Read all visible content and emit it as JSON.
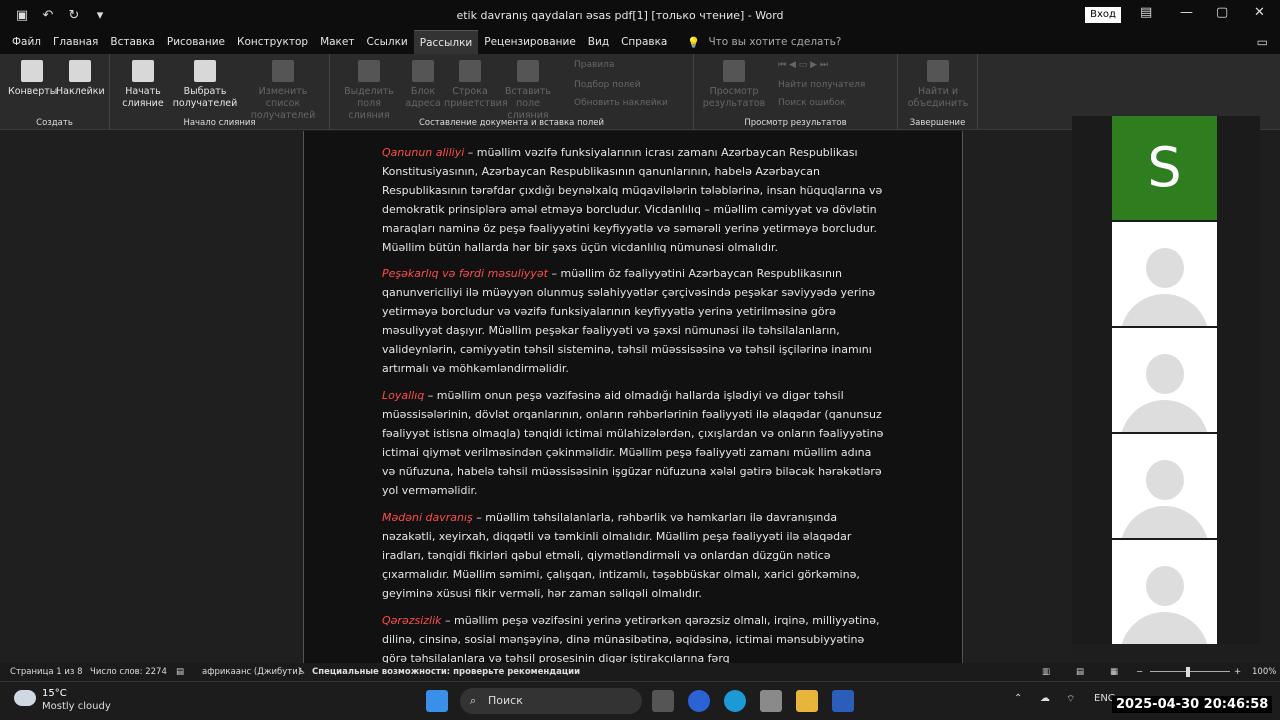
{
  "titlebar": {
    "title": "etik davranış qaydaları əsas pdf[1] [только чтение] - Word",
    "signin": "Вход"
  },
  "menu": [
    "Файл",
    "Главная",
    "Вставка",
    "Рисование",
    "Конструктор",
    "Макет",
    "Ссылки",
    "Рассылки",
    "Рецензирование",
    "Вид",
    "Справка"
  ],
  "menu_active": "Рассылки",
  "tellme": "Что вы хотите сделать?",
  "ribbon": {
    "groups": [
      "Создать",
      "Начало слияния",
      "Составление документа и вставка полей",
      "Просмотр результатов",
      "Завершение"
    ],
    "create": {
      "envelopes": "Конверты",
      "labels": "Наклейки"
    },
    "start": {
      "start_merge": "Начать слияние",
      "select_recipients": "Выбрать получателей",
      "edit_list": "Изменить список получателей"
    },
    "write": {
      "highlight": "Выделить поля слияния",
      "address": "Блок адреса",
      "greeting": "Строка приветствия",
      "insert_field": "Вставить поле слияния",
      "rules": "Правила",
      "match": "Подбор полей",
      "update": "Обновить наклейки"
    },
    "preview": {
      "preview": "Просмотр результатов",
      "find_recipient": "Найти получателя",
      "check_errors": "Поиск ошибок"
    },
    "finish": {
      "finish": "Найти и объединить"
    }
  },
  "document": {
    "paragraphs": [
      {
        "term": "Qanunun aliliyi",
        "text": " – müəllim vəzifə funksiyalarının icrası zamanı Azərbaycan Respublikası Konstitusiyasının, Azərbaycan Respublikasının qanunlarının, habelə Azərbaycan Respublikasının tərəfdar çıxdığı beynəlxalq müqavilələrin tələblərinə, insan hüquqlarına və demokratik prinsiplərə əməl etməyə borcludur. Vicdanlılıq – müəllim cəmiyyət və dövlətin maraqları naminə öz peşə fəaliyyətini keyfiyyətlə və səmərəli yerinə yetirməyə borcludur. Müəllim bütün hallarda hər bir şəxs üçün vicdanlılıq nümunəsi olmalıdır."
      },
      {
        "term": "Peşəkarlıq və fərdi məsuliyyət",
        "text": " – müəllim öz fəaliyyətini Azərbaycan Respublikasının qanunvericiliyi ilə müəyyən olunmuş səlahiyyətlər çərçivəsində peşəkar səviyyədə yerinə yetirməyə borcludur və vəzifə funksiyalarının keyfiyyətlə yerinə yetirilməsinə görə məsuliyyət daşıyır. Müəllim peşəkar fəaliyyəti və şəxsi nümunəsi ilə təhsilalanların, valideynlərin, cəmiyyətin təhsil sisteminə, təhsil müəssisəsinə və təhsil işçilərinə inamını artırmalı və möhkəmləndirməlidir."
      },
      {
        "term": "Loyallıq",
        "text": " – müəllim onun peşə vəzifəsinə aid olmadığı hallarda işlədiyi və digər təhsil müəssisələrinin, dövlət orqanlarının, onların rəhbərlərinin fəaliyyəti ilə əlaqədar (qanunsuz fəaliyyət istisna olmaqla) tənqidi ictimai mülahizələrdən, çıxışlardan və onların fəaliyyətinə ictimai qiymət verilməsindən çəkinməlidir. Müəllim peşə fəaliyyəti zamanı müəllim adına və nüfuzuna, habelə təhsil müəssisəsinin işgüzar nüfuzuna xələl gətirə biləcək hərəkətlərə yol verməməlidir."
      },
      {
        "term": "Mədəni davranış",
        "text": " – müəllim təhsilalanlarla, rəhbərlik və həmkarları ilə davranışında nəzakətli, xeyirxah, diqqətli və təmkinli olmalıdır. Müəllim peşə fəaliyyəti ilə əlaqədar iradları, tənqidi fikirləri qəbul etməli, qiymətləndirməli və onlardan düzgün nəticə çıxarmalıdır. Müəllim səmimi, çalışqan, intizamlı, təşəbbüskar olmalı, xarici görkəminə, geyiminə xüsusi fikir verməli, hər zaman səliqəli olmalıdır."
      },
      {
        "term": "Qərəzsizlik",
        "text": " – müəllim peşə vəzifəsini yerinə yetirərkən qərəzsiz olmalı, irqinə, milliyyətinə, dilinə, cinsinə, sosial mənşəyinə, dinə münasibətinə, əqidəsinə, ictimai mənsubiyyətinə görə təhsilalanlara və təhsil prosesinin digər iştirakçılarına fərq"
      }
    ]
  },
  "video": {
    "presenter_initial": "S"
  },
  "status": {
    "page": "Страница 1 из 8",
    "words": "Число слов: 2274",
    "language": "африкаанс (Джибути)",
    "accessibility": "Специальные возможности: проверьте рекомендации",
    "zoom": "100%"
  },
  "taskbar": {
    "temp": "15°C",
    "weather": "Mostly cloudy",
    "search": "Поиск",
    "lang": "ENG",
    "clock": "2025-04-30 20:46:58"
  },
  "colors": {
    "term": "#ff4d4d",
    "presenter_tile": "#2e7d1f"
  }
}
